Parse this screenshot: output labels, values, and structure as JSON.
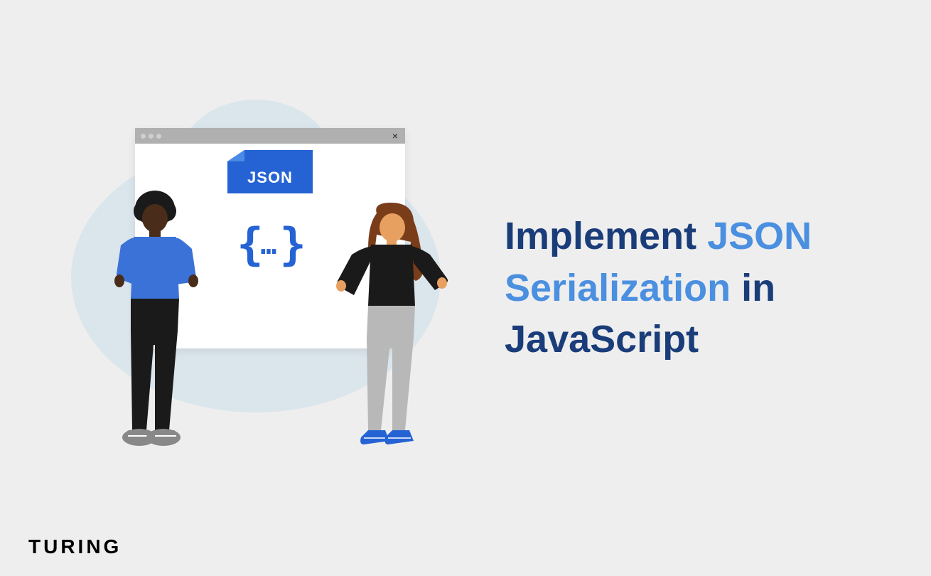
{
  "title": {
    "part1": "Implement ",
    "highlight": "JSON Serialization",
    "part2": " in JavaScript"
  },
  "browser": {
    "json_label": "JSON",
    "braces_open": "{",
    "braces_dots": "…",
    "braces_close": "}",
    "close_glyph": "×"
  },
  "brand": "TURING"
}
